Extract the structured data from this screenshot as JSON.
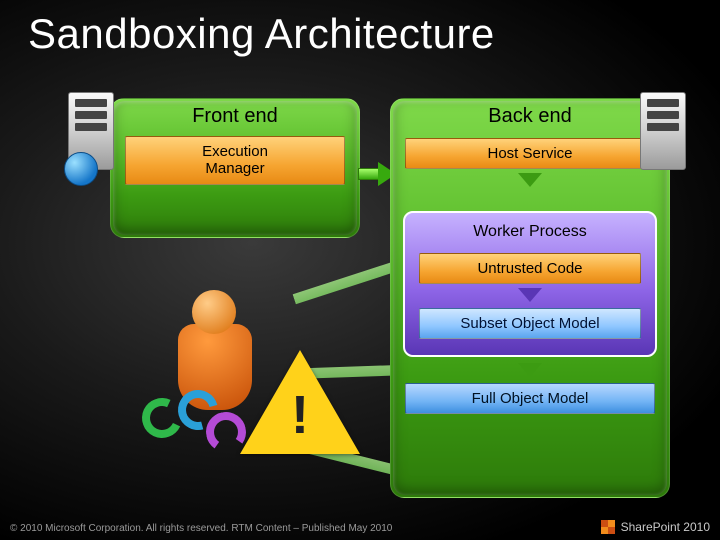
{
  "title": "Sandboxing Architecture",
  "front": {
    "heading": "Front end",
    "execution_manager": "Execution\nManager"
  },
  "back": {
    "heading": "Back end",
    "host_service": "Host Service",
    "worker_process": "Worker Process",
    "untrusted_code": "Untrusted Code",
    "subset_om": "Subset Object Model",
    "full_om": "Full Object Model"
  },
  "footer": {
    "copyright": "© 2010 Microsoft Corporation. All rights reserved. RTM Content – Published May 2010",
    "product": "SharePoint 2010"
  }
}
